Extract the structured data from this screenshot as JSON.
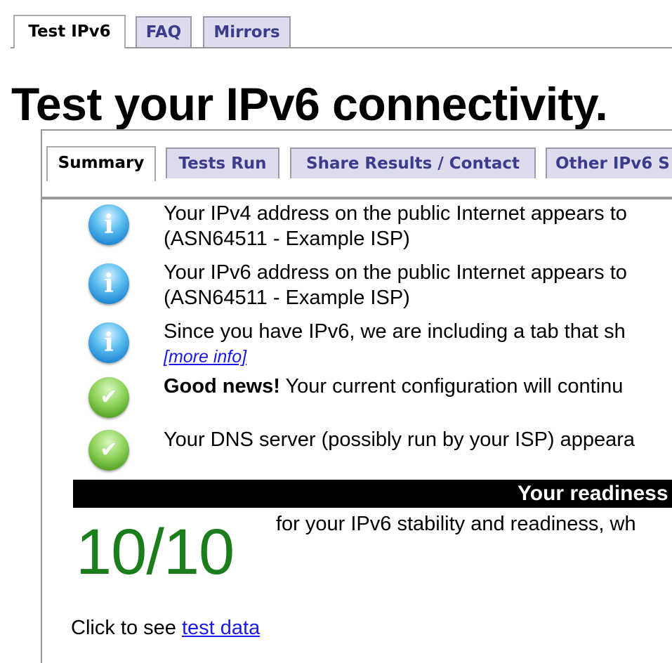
{
  "top_tabs": [
    {
      "label": "Test IPv6",
      "active": true
    },
    {
      "label": "FAQ",
      "active": false
    },
    {
      "label": "Mirrors",
      "active": false
    }
  ],
  "page_title": "Test your IPv6 connectivity.",
  "inner_tabs": [
    {
      "label": "Summary",
      "active": true
    },
    {
      "label": "Tests Run",
      "active": false
    },
    {
      "label": "Share Results / Contact",
      "active": false
    },
    {
      "label": "Other IPv6 S",
      "active": false
    }
  ],
  "results": [
    {
      "icon": "info-icon",
      "line1": "Your IPv4 address on the public Internet appears to",
      "line2": "(ASN64511 - Example ISP)"
    },
    {
      "icon": "info-icon",
      "line1": "Your IPv6 address on the public Internet appears to",
      "line2": "(ASN64511 - Example ISP)"
    },
    {
      "icon": "info-icon",
      "line1": "Since you have IPv6, we are including a tab that sh",
      "link": "[more info]"
    },
    {
      "icon": "check-icon",
      "bold": "Good news!",
      "line1": " Your current configuration will continu"
    },
    {
      "icon": "check-icon",
      "line1": "Your DNS server (possibly run by your ISP) appeara"
    }
  ],
  "readiness": {
    "bar_text": "Your readiness",
    "score": "10/10",
    "description": "for your IPv6 stability and readiness, wh"
  },
  "test_data": {
    "prefix": "Click to see ",
    "link": "test data"
  }
}
